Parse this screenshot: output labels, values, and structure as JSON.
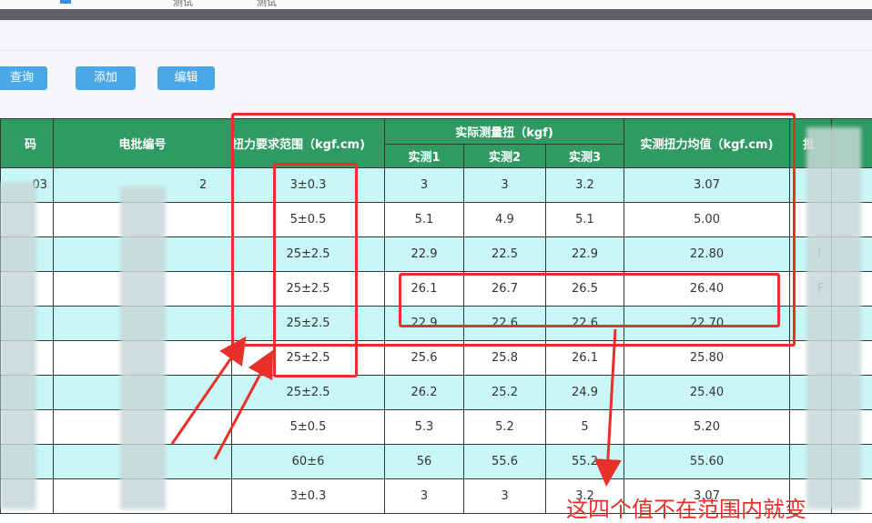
{
  "top": {
    "tab1": "测试",
    "tab2": "测试"
  },
  "toolbar": {
    "query": "查询",
    "add": "添加",
    "edit": "编辑"
  },
  "table": {
    "col_code": "码",
    "col_batch": "电批编号",
    "col_range": "扭力要求范围（kgf.cm)",
    "col_measure_group": "实际测量扭（kgf)",
    "col_m1": "实测1",
    "col_m2": "实测2",
    "col_m3": "实测3",
    "col_avg": "实测扭力均值（kgf.cm)",
    "col_extra": "批",
    "rows": [
      {
        "code": "03",
        "batch": "2",
        "range": "3±0.3",
        "m1": "3",
        "m2": "3",
        "m3": "3.2",
        "avg": "3.07",
        "extra": ""
      },
      {
        "code": "",
        "batch": "",
        "range": "5±0.5",
        "m1": "5.1",
        "m2": "4.9",
        "m3": "5.1",
        "avg": "5.00",
        "extra": ""
      },
      {
        "code": "",
        "batch": "",
        "range": "25±2.5",
        "m1": "22.9",
        "m2": "22.5",
        "m3": "22.9",
        "avg": "22.80",
        "extra": "I"
      },
      {
        "code": "",
        "batch": "",
        "range": "25±2.5",
        "m1": "26.1",
        "m2": "26.7",
        "m3": "26.5",
        "avg": "26.40",
        "extra": "F"
      },
      {
        "code": "",
        "batch": "",
        "range": "25±2.5",
        "m1": "22.9",
        "m2": "22.6",
        "m3": "22.6",
        "avg": "22.70",
        "extra": ""
      },
      {
        "code": "",
        "batch": "",
        "range": "25±2.5",
        "m1": "25.6",
        "m2": "25.8",
        "m3": "26.1",
        "avg": "25.80",
        "extra": ""
      },
      {
        "code": "",
        "batch": "",
        "range": "25±2.5",
        "m1": "26.2",
        "m2": "25.2",
        "m3": "24.9",
        "avg": "25.40",
        "extra": ""
      },
      {
        "code": "",
        "batch": "",
        "range": "5±0.5",
        "m1": "5.3",
        "m2": "5.2",
        "m3": "5",
        "avg": "5.20",
        "extra": ""
      },
      {
        "code": "",
        "batch": "",
        "range": "60±6",
        "m1": "56",
        "m2": "55.6",
        "m3": "55.2",
        "avg": "55.60",
        "extra": ""
      },
      {
        "code": "",
        "batch": "",
        "range": "3±0.3",
        "m1": "3",
        "m2": "3",
        "m3": "3.2",
        "avg": "3.07",
        "extra": ""
      }
    ]
  },
  "annotation": {
    "text": "这四个值不在范围内就变"
  },
  "colors": {
    "header": "#2f9a62",
    "row_alt": "#c9f7f7",
    "button": "#4aa8e8",
    "annotation": "#e8302a"
  }
}
